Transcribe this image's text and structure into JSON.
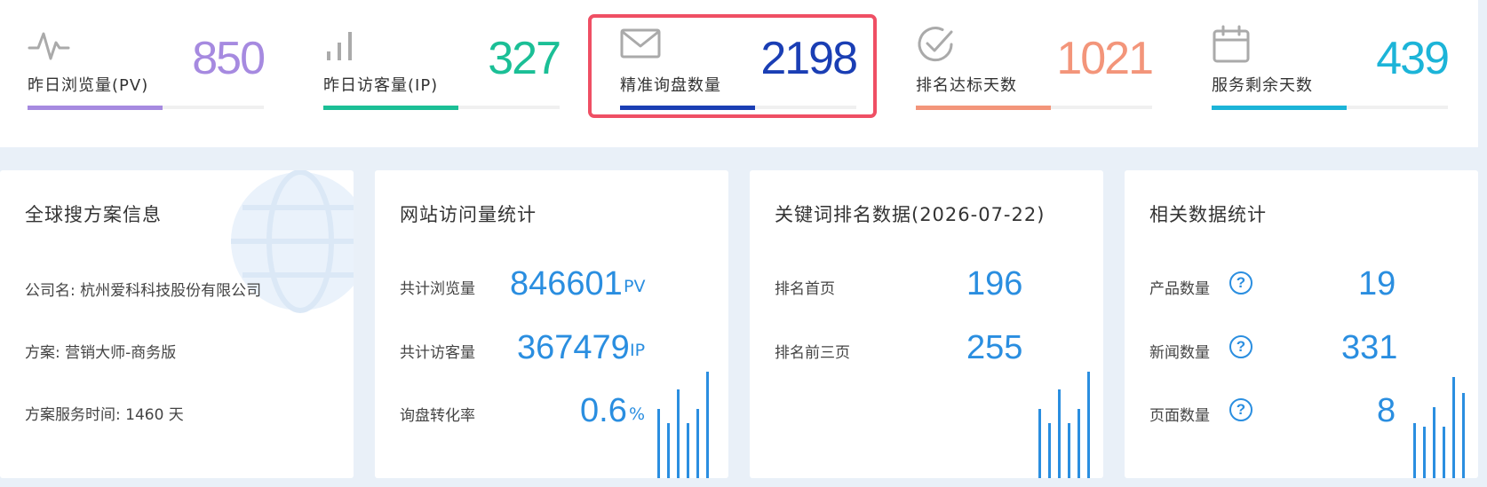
{
  "top_stats": [
    {
      "label": "昨日浏览量(PV)",
      "value": "850",
      "color": "#a68ae0",
      "icon": "activity-pulse-icon"
    },
    {
      "label": "昨日访客量(IP)",
      "value": "327",
      "color": "#1bbf96",
      "icon": "bar-signal-icon"
    },
    {
      "label": "精准询盘数量",
      "value": "2198",
      "color": "#1a3eb4",
      "icon": "mail-envelope-icon"
    },
    {
      "label": "排名达标天数",
      "value": "1021",
      "color": "#f3957a",
      "icon": "check-circle-icon"
    },
    {
      "label": "服务剩余天数",
      "value": "439",
      "color": "#1cb4d8",
      "icon": "calendar-icon"
    }
  ],
  "plan_card": {
    "title": "全球搜方案信息",
    "company": "公司名: 杭州爱科科技股份有限公司",
    "plan": "方案: 营销大师-商务版",
    "service_time": "方案服务时间: 1460 天"
  },
  "traffic_card": {
    "title": "网站访问量统计",
    "rows": [
      {
        "label": "共计浏览量",
        "value": "846601",
        "unit": "PV"
      },
      {
        "label": "共计访客量",
        "value": "367479",
        "unit": "IP"
      },
      {
        "label": "询盘转化率",
        "value": "0.6",
        "unit": "%"
      }
    ]
  },
  "keyword_card": {
    "title": "关键词排名数据(2026-07-22)",
    "rows": [
      {
        "label": "排名首页",
        "value": "196"
      },
      {
        "label": "排名前三页",
        "value": "255"
      }
    ]
  },
  "related_card": {
    "title": "相关数据统计",
    "rows": [
      {
        "label": "产品数量",
        "value": "19"
      },
      {
        "label": "新闻数量",
        "value": "331"
      },
      {
        "label": "页面数量",
        "value": "8"
      }
    ],
    "help_glyph": "?"
  },
  "colors": {
    "accent": "#2a8ee0",
    "highlight": "#ef4f64",
    "background": "#e9f0f8"
  }
}
